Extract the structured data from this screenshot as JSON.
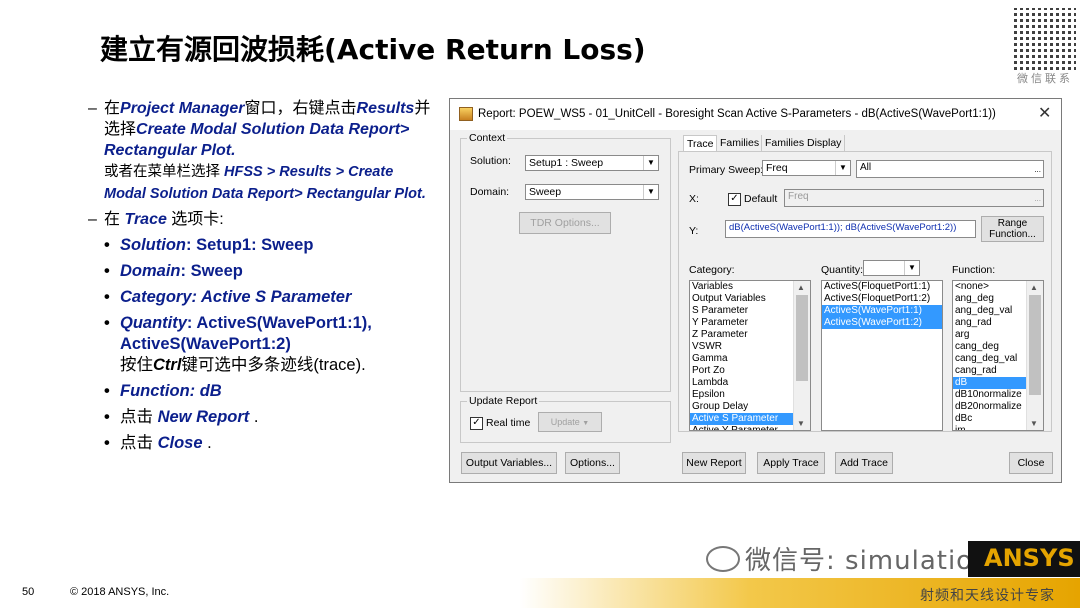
{
  "slide": {
    "title": "建立有源回波损耗(Active Return Loss)",
    "page_number": "50",
    "copyright": "© 2018 ANSYS, Inc.",
    "watermark": "微信号: simulation",
    "brand": "ANSYS",
    "watermark_sub": "射频和天线设计专家",
    "qr_label": "微信联系"
  },
  "bullets": {
    "b1": {
      "p1": "在",
      "p2": "Project Manager",
      "p3": "窗口，右键点击",
      "p4": "Results",
      "p5": "并选择",
      "p6": "Create Modal Solution Data Report> Rectangular Plot.",
      "p7": "或者在菜单栏选择 ",
      "p8": "HFSS > Results > Create Modal Solution Data Report> Rectangular Plot."
    },
    "b2": {
      "p1": "在 ",
      "p2": "Trace",
      "p3": " 选项卡:"
    },
    "s1": {
      "k": "Solution",
      "v": ": Setup1: Sweep"
    },
    "s2": {
      "k": "Domain",
      "v": ": Sweep"
    },
    "s3": {
      "k": "Category: Active S Parameter"
    },
    "s4": {
      "k": "Quantity",
      "v": ": ActiveS(WavePort1:1), ActiveS(WavePort1:2)",
      "note1": "按住",
      "note2": "Ctrl",
      "note3": "键可选中多条迹线(trace)."
    },
    "s5": {
      "k": "Function: dB"
    },
    "s6": {
      "p1": "点击 ",
      "p2": "New Report",
      "p3": " ."
    },
    "s7": {
      "p1": "点击 ",
      "p2": "Close",
      "p3": " ."
    }
  },
  "dialog": {
    "title": "Report: POEW_WS5 - 01_UnitCell - Boresight Scan Active S-Parameters - dB(ActiveS(WavePort1:1))",
    "close": "✕",
    "context_label": "Context",
    "solution_label": "Solution:",
    "solution_value": "Setup1 : Sweep",
    "domain_label": "Domain:",
    "domain_value": "Sweep",
    "tdr_button": "TDR Options...",
    "update_report_label": "Update Report",
    "real_time_label": "Real time",
    "update_button": "Update",
    "tabs": [
      "Trace",
      "Families",
      "Families Display"
    ],
    "primary_sweep_label": "Primary Sweep:",
    "primary_sweep_value": "Freq",
    "all_value": "All",
    "x_label": "X:",
    "default_label": "Default",
    "x_value": "Freq",
    "y_label": "Y:",
    "y_value": "dB(ActiveS(WavePort1:1)); dB(ActiveS(WavePort1:2))",
    "range_function_button": "Range Function...",
    "category_label": "Category:",
    "quantity_label": "Quantity:",
    "function_label": "Function:",
    "categories": [
      "Variables",
      "Output Variables",
      "S Parameter",
      "Y Parameter",
      "Z Parameter",
      "VSWR",
      "Gamma",
      "Port Zo",
      "Lambda",
      "Epsilon",
      "Group Delay",
      "Active S Parameter",
      "Active Y Parameter"
    ],
    "quantities": [
      "ActiveS(FloquetPort1:1)",
      "ActiveS(FloquetPort1:2)",
      "ActiveS(WavePort1:1)",
      "ActiveS(WavePort1:2)"
    ],
    "functions": [
      "<none>",
      "ang_deg",
      "ang_deg_val",
      "ang_rad",
      "arg",
      "cang_deg",
      "cang_deg_val",
      "cang_rad",
      "dB",
      "dB10normalize",
      "dB20normalize",
      "dBc",
      "im"
    ],
    "output_variables_button": "Output Variables...",
    "options_button": "Options...",
    "new_report_button": "New Report",
    "apply_trace_button": "Apply Trace",
    "add_trace_button": "Add Trace",
    "close_button": "Close",
    "check_mark": "✓",
    "dots": "..."
  }
}
